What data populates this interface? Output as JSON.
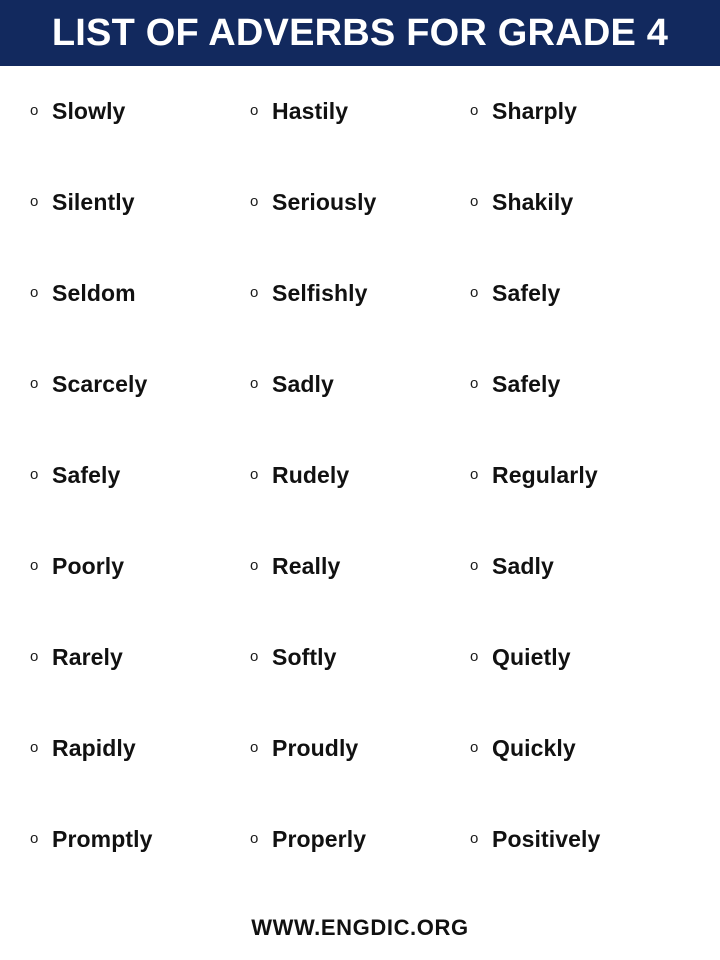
{
  "header": {
    "title": "LIST OF ADVERBS FOR GRADE 4",
    "background_color": "#12295e",
    "text_color": "#ffffff"
  },
  "list": {
    "bullet_glyph": "o",
    "columns": 3,
    "rows": [
      [
        "Slowly",
        "Hastily",
        "Sharply"
      ],
      [
        "Silently",
        "Seriously",
        "Shakily"
      ],
      [
        "Seldom",
        "Selfishly",
        "Safely"
      ],
      [
        "Scarcely",
        "Sadly",
        "Safely"
      ],
      [
        "Safely",
        "Rudely",
        "Regularly"
      ],
      [
        "Poorly",
        "Really",
        "Sadly"
      ],
      [
        "Rarely",
        "Softly",
        "Quietly"
      ],
      [
        "Rapidly",
        "Proudly",
        "Quickly"
      ],
      [
        "Promptly",
        "Properly",
        "Positively"
      ]
    ]
  },
  "footer": {
    "text": "WWW.ENGDIC.ORG"
  }
}
